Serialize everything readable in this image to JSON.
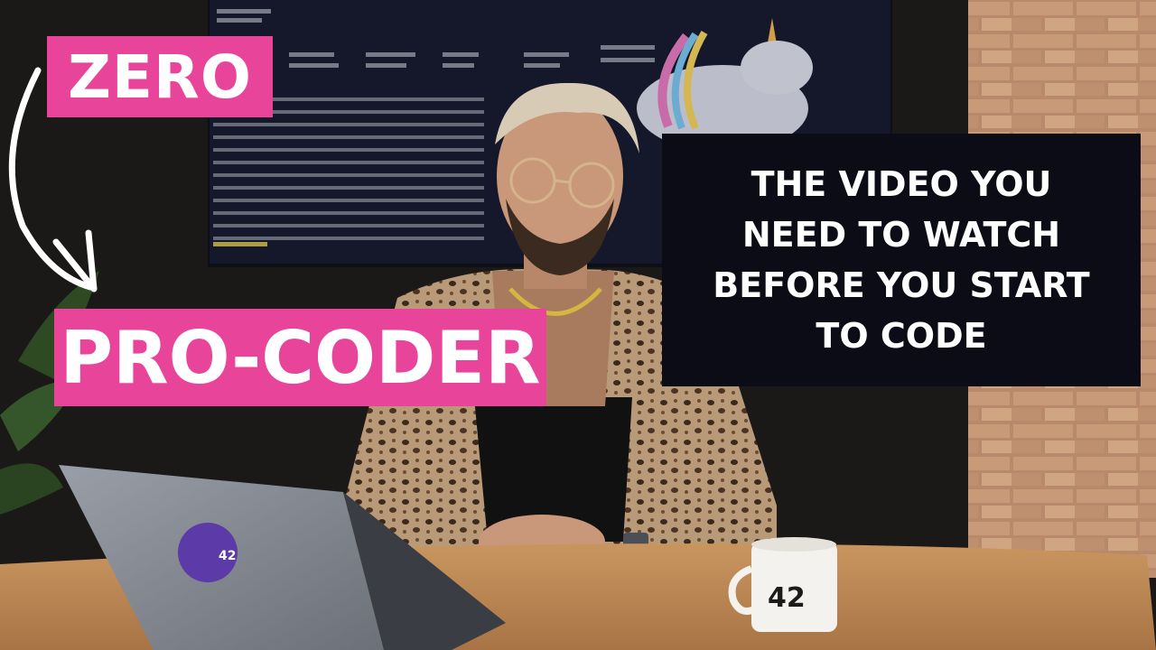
{
  "overlay": {
    "zero_label": "ZERO",
    "procoder_label": "PRO-CODER",
    "headline_lines": [
      "THE VIDEO YOU",
      "NEED TO WATCH",
      "BEFORE YOU START",
      "TO CODE"
    ]
  },
  "scene": {
    "mug_text": "42",
    "laptop_sticker_text": "42"
  },
  "colors": {
    "accent_pink": "#e8449a",
    "headline_bg": "#0b0c16",
    "text": "#ffffff"
  },
  "icons": [
    "curved-arrow-icon"
  ]
}
